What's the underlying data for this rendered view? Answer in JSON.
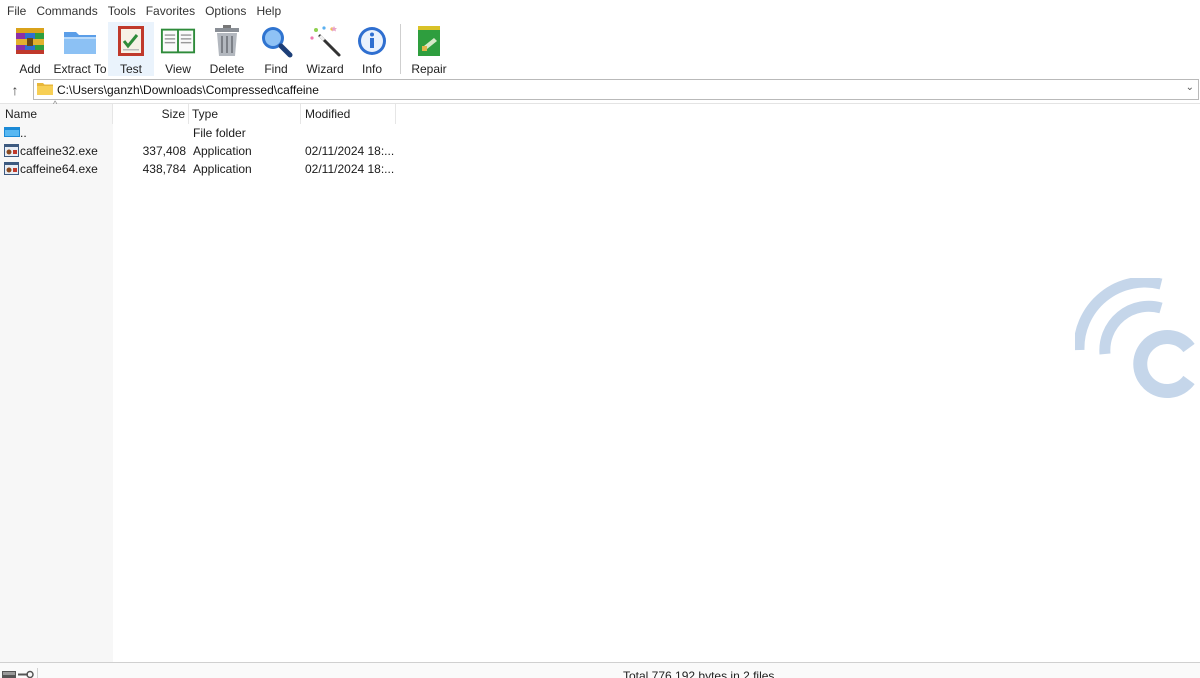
{
  "menu": {
    "items": [
      "File",
      "Commands",
      "Tools",
      "Favorites",
      "Options",
      "Help"
    ]
  },
  "toolbar": {
    "buttons": [
      {
        "label": "Add",
        "icon": "add-archive-icon"
      },
      {
        "label": "Extract To",
        "icon": "extract-folder-icon"
      },
      {
        "label": "Test",
        "icon": "test-checklist-icon"
      },
      {
        "label": "View",
        "icon": "view-book-icon"
      },
      {
        "label": "Delete",
        "icon": "trash-icon"
      },
      {
        "label": "Find",
        "icon": "magnifier-icon"
      },
      {
        "label": "Wizard",
        "icon": "magic-wand-icon"
      },
      {
        "label": "Info",
        "icon": "info-icon"
      },
      {
        "label": "Repair",
        "icon": "repair-icon"
      }
    ]
  },
  "address": {
    "path": "C:\\Users\\ganzh\\Downloads\\Compressed\\caffeine"
  },
  "columns": {
    "name": "Name",
    "size": "Size",
    "type": "Type",
    "modified": "Modified"
  },
  "files": [
    {
      "name": "..",
      "size": "",
      "type": "File folder",
      "modified": "",
      "icon": "parent-folder-icon"
    },
    {
      "name": "caffeine32.exe",
      "size": "337,408",
      "type": "Application",
      "modified": "02/11/2024 18:...",
      "icon": "exe-file-icon"
    },
    {
      "name": "caffeine64.exe",
      "size": "438,784",
      "type": "Application",
      "modified": "02/11/2024 18:...",
      "icon": "exe-file-icon"
    }
  ],
  "status": {
    "text": "Total 776,192 bytes in 2 files"
  },
  "colors": {
    "accent": "#0a7bd6",
    "selected_tool_bg": "#eaf3fc",
    "watermark": "#c5d6ea"
  }
}
